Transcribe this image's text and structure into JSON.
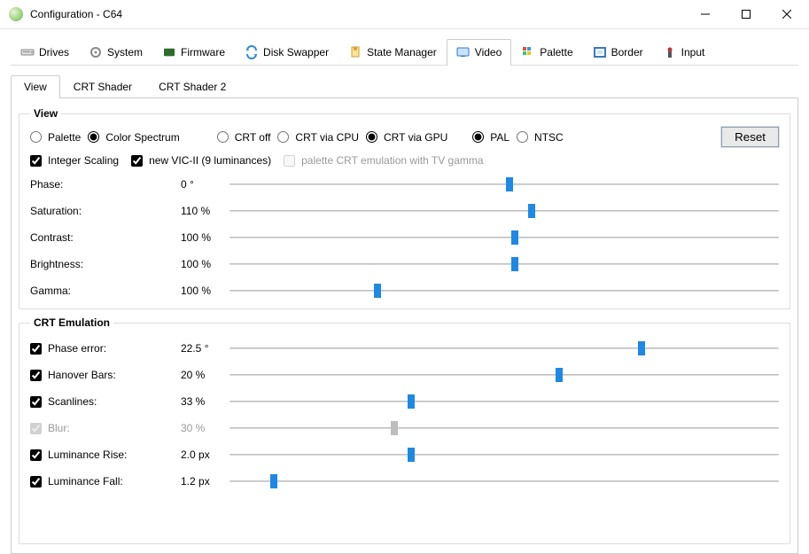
{
  "window": {
    "title": "Configuration - C64"
  },
  "tabs": [
    {
      "id": "drives",
      "label": "Drives"
    },
    {
      "id": "system",
      "label": "System"
    },
    {
      "id": "firmware",
      "label": "Firmware"
    },
    {
      "id": "disk-swapper",
      "label": "Disk Swapper"
    },
    {
      "id": "state-manager",
      "label": "State Manager"
    },
    {
      "id": "video",
      "label": "Video"
    },
    {
      "id": "palette",
      "label": "Palette"
    },
    {
      "id": "border",
      "label": "Border"
    },
    {
      "id": "input",
      "label": "Input"
    }
  ],
  "active_tab": "video",
  "subtabs": [
    {
      "id": "view",
      "label": "View"
    },
    {
      "id": "crt-shader",
      "label": "CRT Shader"
    },
    {
      "id": "crt-shader-2",
      "label": "CRT Shader 2"
    }
  ],
  "active_subtab": "view",
  "view": {
    "legend": "View",
    "radios1": {
      "palette": "Palette",
      "color_spectrum": "Color Spectrum"
    },
    "radios2": {
      "crt_off": "CRT off",
      "crt_cpu": "CRT via CPU",
      "crt_gpu": "CRT via GPU"
    },
    "radios3": {
      "pal": "PAL",
      "ntsc": "NTSC"
    },
    "reset_label": "Reset",
    "checks": {
      "integer_scaling": "Integer Scaling",
      "new_vic": "new VIC-II (9 luminances)",
      "palette_crt_gamma": "palette CRT emulation with TV gamma"
    },
    "sliders": {
      "phase": {
        "label": "Phase:",
        "value": "0 °",
        "pos": 51
      },
      "saturation": {
        "label": "Saturation:",
        "value": "110 %",
        "pos": 55
      },
      "contrast": {
        "label": "Contrast:",
        "value": "100 %",
        "pos": 52
      },
      "brightness": {
        "label": "Brightness:",
        "value": "100 %",
        "pos": 52
      },
      "gamma": {
        "label": "Gamma:",
        "value": "100 %",
        "pos": 27
      }
    }
  },
  "crt": {
    "legend": "CRT Emulation",
    "sliders": {
      "phase_error": {
        "label": "Phase error:",
        "value": "22.5 °",
        "pos": 75,
        "checked": true
      },
      "hanover_bars": {
        "label": "Hanover Bars:",
        "value": "20 %",
        "pos": 60,
        "checked": true
      },
      "scanlines": {
        "label": "Scanlines:",
        "value": "33 %",
        "pos": 33,
        "checked": true
      },
      "blur": {
        "label": "Blur:",
        "value": "30 %",
        "pos": 30,
        "checked": true,
        "disabled": true
      },
      "luminance_rise": {
        "label": "Luminance Rise:",
        "value": "2.0 px",
        "pos": 33,
        "checked": true
      },
      "luminance_fall": {
        "label": "Luminance Fall:",
        "value": "1.2 px",
        "pos": 8,
        "checked": true
      }
    }
  }
}
